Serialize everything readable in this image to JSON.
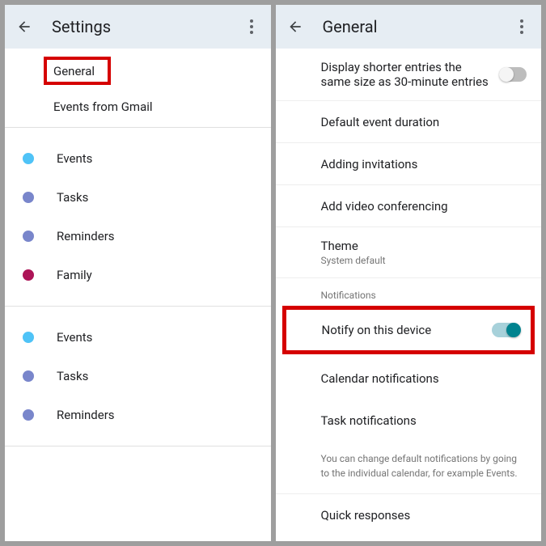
{
  "left": {
    "header_title": "Settings",
    "general": "General",
    "events_from_gmail": "Events from Gmail",
    "group1": [
      {
        "label": "Events",
        "color": "dot-blue"
      },
      {
        "label": "Tasks",
        "color": "dot-purple"
      },
      {
        "label": "Reminders",
        "color": "dot-purple"
      },
      {
        "label": "Family",
        "color": "dot-magenta"
      }
    ],
    "group2": [
      {
        "label": "Events",
        "color": "dot-blue"
      },
      {
        "label": "Tasks",
        "color": "dot-purple"
      },
      {
        "label": "Reminders",
        "color": "dot-purple"
      }
    ]
  },
  "right": {
    "header_title": "General",
    "display_shorter": "Display shorter entries the same size as 30-minute entries",
    "default_duration": "Default event duration",
    "adding_invitations": "Adding invitations",
    "add_video": "Add video conferencing",
    "theme_label": "Theme",
    "theme_value": "System default",
    "notifications_section": "Notifications",
    "notify_device": "Notify on this device",
    "calendar_notifications": "Calendar notifications",
    "task_notifications": "Task notifications",
    "info_text": "You can change default notifications by going to the individual calendar, for example Events.",
    "quick_responses": "Quick responses"
  }
}
